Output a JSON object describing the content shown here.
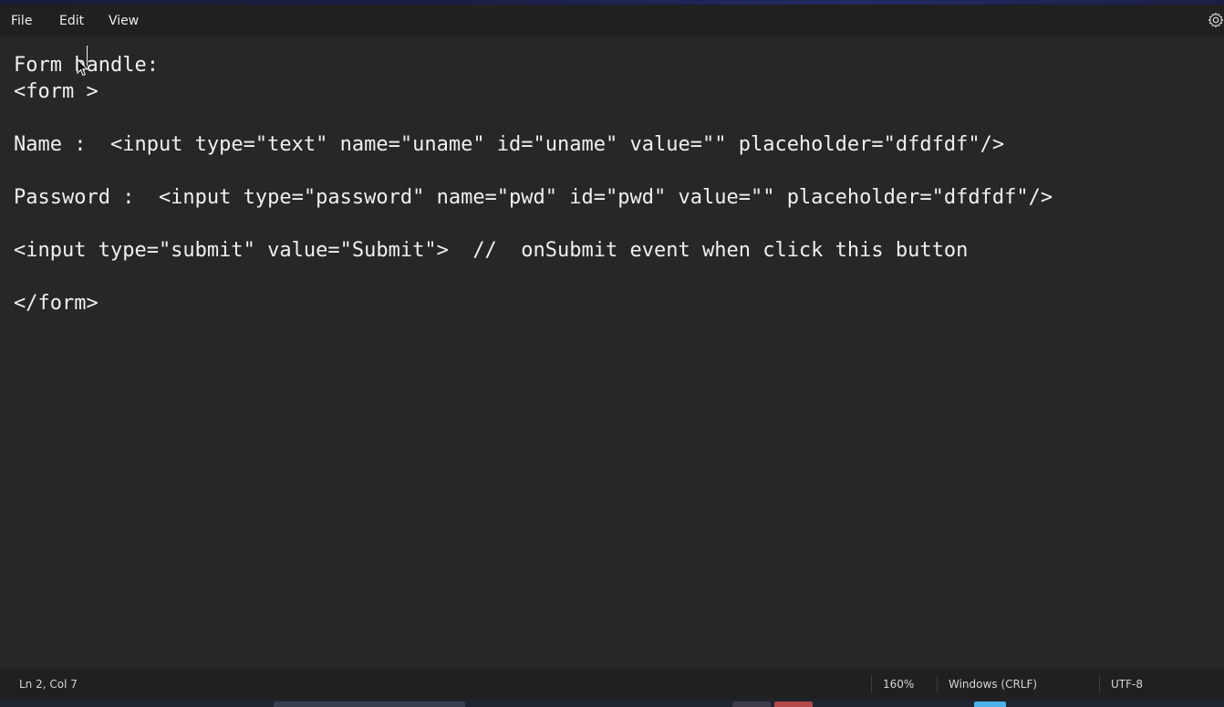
{
  "menu": {
    "file_label": "File",
    "edit_label": "Edit",
    "view_label": "View",
    "settings_icon": "gear-icon"
  },
  "editor": {
    "lines": [
      "Form handle:",
      "<form >",
      "",
      "Name :  <input type=\"text\" name=\"uname\" id=\"uname\" value=\"\" placeholder=\"dfdfdf\"/>",
      "",
      "Password :  <input type=\"password\" name=\"pwd\" id=\"pwd\" value=\"\" placeholder=\"dfdfdf\"/>",
      "",
      "<input type=\"submit\" value=\"Submit\">  //  onSubmit event when click this button",
      "",
      "</form>"
    ]
  },
  "status": {
    "position": "Ln 2, Col 7",
    "zoom": "160%",
    "line_ending": "Windows (CRLF)",
    "encoding": "UTF-8"
  },
  "colors": {
    "editor_bg": "#272727",
    "bar_bg": "#202020",
    "text": "#f0f0f0"
  }
}
